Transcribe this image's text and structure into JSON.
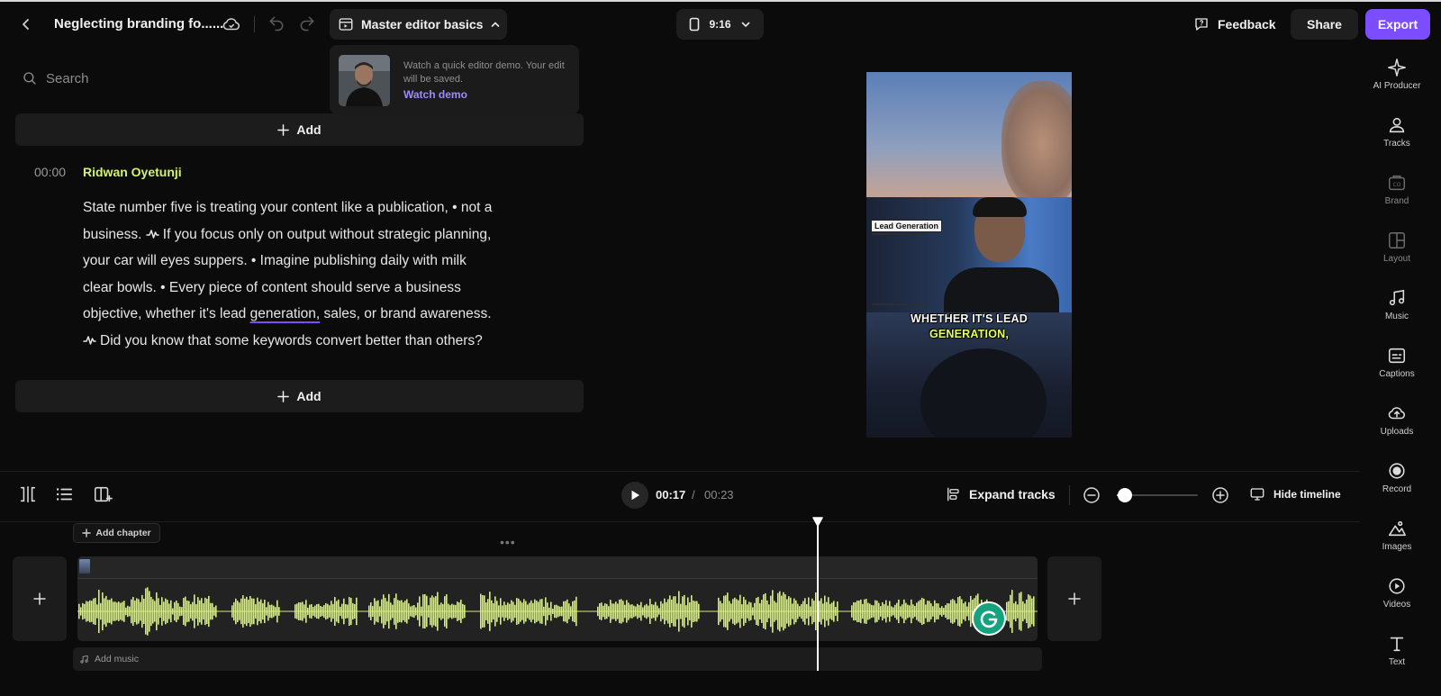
{
  "header": {
    "project_title": "Neglecting branding fo......",
    "master_label": "Master editor basics",
    "aspect_label": "9:16",
    "feedback_label": "Feedback",
    "share_label": "Share",
    "export_label": "Export",
    "accent_color": "#7c4dff"
  },
  "demo_popup": {
    "text": "Watch a quick editor demo. Your edit will be saved.",
    "link": "Watch demo"
  },
  "search": {
    "placeholder": "Search"
  },
  "transcript": {
    "add_label": "Add",
    "timestamp": "00:00",
    "speaker": "Ridwan Oyetunji",
    "lines": [
      {
        "text": "State number five is treating your content like a publication, • not a"
      },
      {
        "before": "business.",
        "after": "If you focus only on output without strategic planning,"
      },
      {
        "text": "your car will eyes suppers. • Imagine publishing daily with milk"
      },
      {
        "text": "clear bowls. • Every piece of content should serve a business"
      },
      {
        "before": "objective, whether it's lead ",
        "highlight": "generation,",
        "after": " sales, or brand awareness."
      },
      {
        "after": "Did you know that some keywords convert better than others?"
      }
    ]
  },
  "preview": {
    "overlay_label": "Lead Generation",
    "caption_line1": "WHETHER IT'S LEAD",
    "caption_line2": "GENERATION,",
    "caption_highlight_color": "#e6ff5a"
  },
  "sidebar": {
    "items": [
      {
        "label": "AI Producer",
        "icon": "sparkle-icon"
      },
      {
        "label": "Tracks",
        "icon": "people-icon"
      },
      {
        "label": "Brand",
        "icon": "brand-icon"
      },
      {
        "label": "Layout",
        "icon": "layout-icon"
      },
      {
        "label": "Music",
        "icon": "music-note-icon"
      },
      {
        "label": "Captions",
        "icon": "captions-icon"
      },
      {
        "label": "Uploads",
        "icon": "upload-cloud-icon"
      },
      {
        "label": "Record",
        "icon": "record-icon"
      },
      {
        "label": "Images",
        "icon": "image-icon"
      },
      {
        "label": "Videos",
        "icon": "video-play-icon"
      },
      {
        "label": "Text",
        "icon": "text-icon"
      }
    ]
  },
  "timeline": {
    "current_time": "00:17",
    "separator": "/",
    "total_time": "00:23",
    "expand_label": "Expand tracks",
    "hide_label": "Hide timeline",
    "zoom_level": 0.1,
    "add_chapter_label": "Add chapter",
    "add_music_label": "Add music",
    "waveform_color": "#d4f26a",
    "playhead_progress": 0.74
  }
}
